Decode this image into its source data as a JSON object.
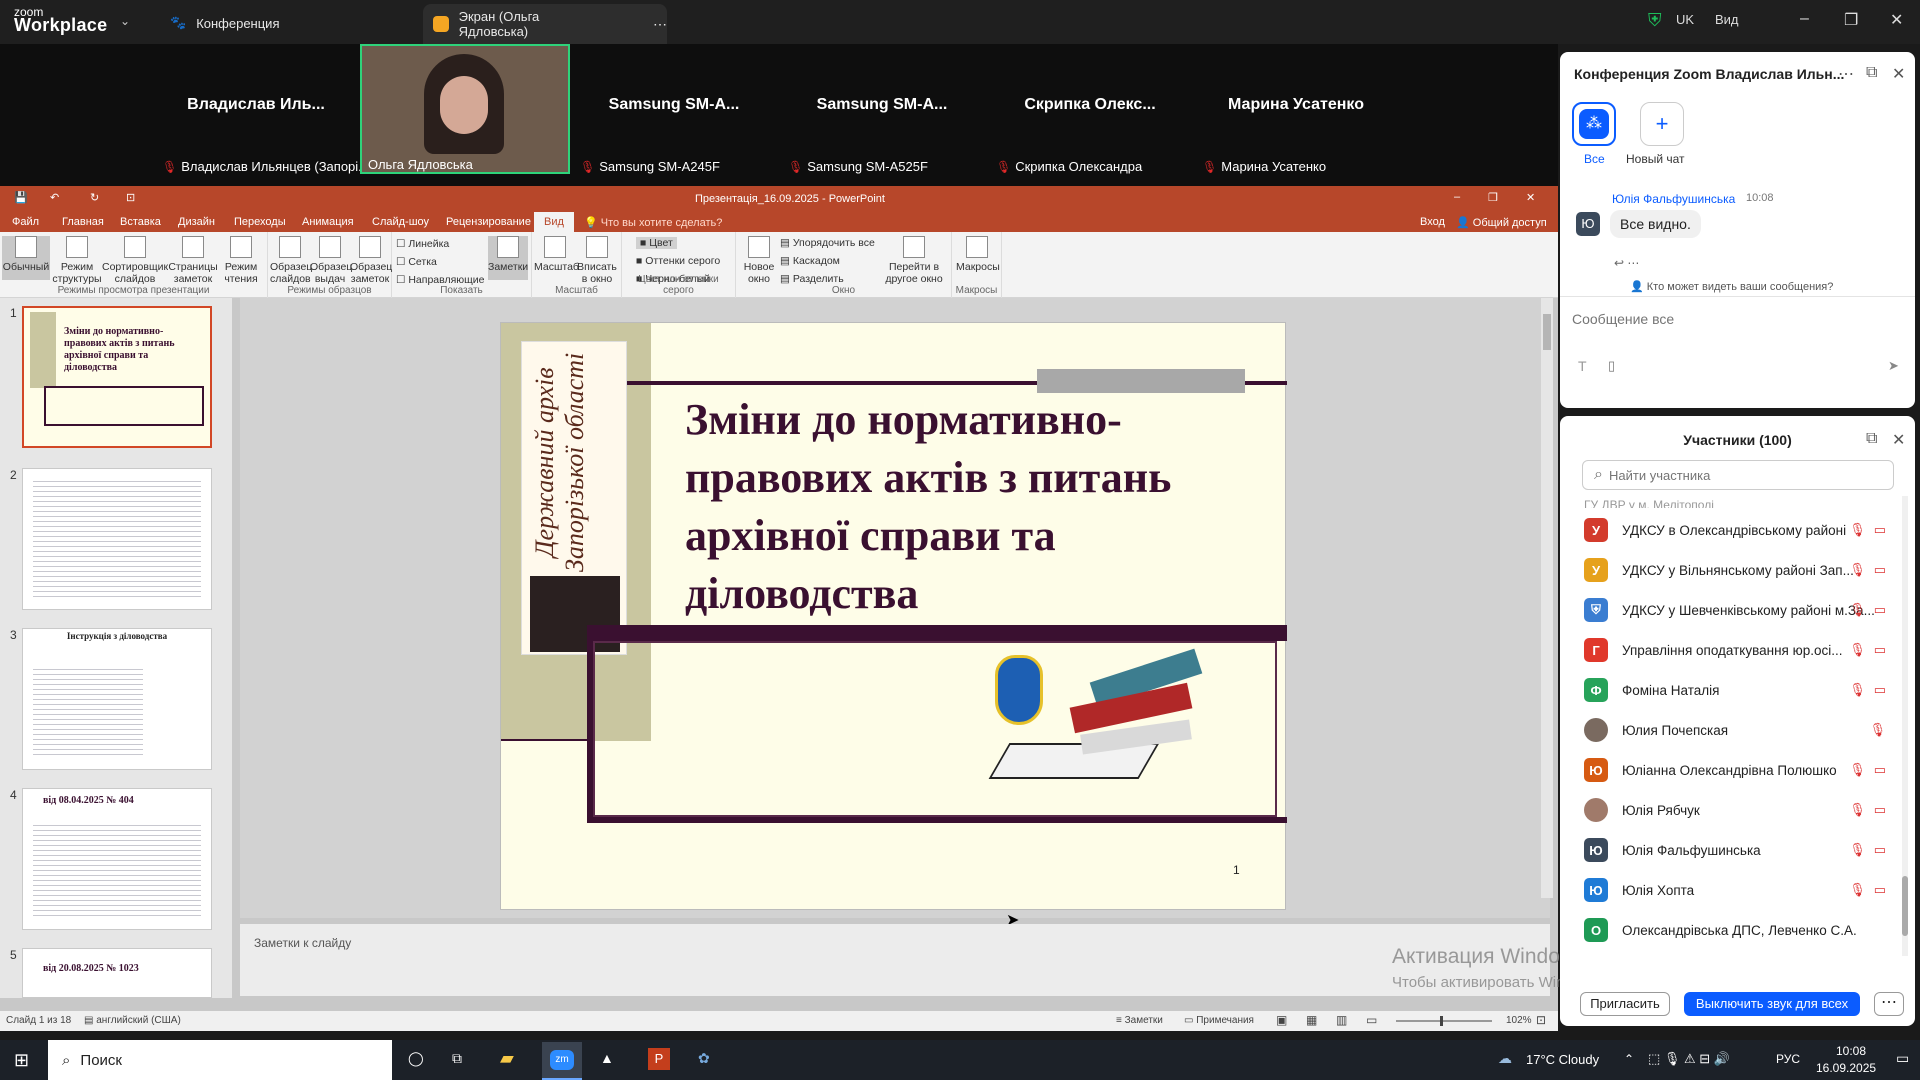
{
  "zoom": {
    "logo_top": "zoom",
    "logo_bottom": "Workplace",
    "tab_conference": "Конференция",
    "tab_screen": "Экран (Ольга Ядловська)",
    "region": "UK",
    "view": "Вид"
  },
  "gallery": [
    {
      "name": "Владислав Иль...",
      "label": "Владислав Ильянцев (Запорі..."
    },
    {
      "name": "",
      "label": "Ольга Ядловська"
    },
    {
      "name": "Samsung SM-A...",
      "label": "Samsung SM-A245F"
    },
    {
      "name": "Samsung SM-A...",
      "label": "Samsung SM-A525F"
    },
    {
      "name": "Скрипка Олекс...",
      "label": "Скрипка Олександра"
    },
    {
      "name": "Марина Усатенко",
      "label": "Марина Усатенко"
    }
  ],
  "ppt": {
    "title": "Презентація_16.09.2025 - PowerPoint",
    "menu": [
      "Файл",
      "Главная",
      "Вставка",
      "Дизайн",
      "Переходы",
      "Анимация",
      "Слайд-шоу",
      "Рецензирование",
      "Вид"
    ],
    "tell_me": "Что вы хотите сделать?",
    "signin": "Вход",
    "share": "Общий доступ",
    "ribbon": {
      "views": [
        "Обычный",
        "Режим структуры",
        "Сортировщик слайдов",
        "Страницы заметок",
        "Режим чтения"
      ],
      "views_label": "Режимы просмотра презентации",
      "masters": [
        "Образец слайдов",
        "Образец выдач",
        "Образец заметок"
      ],
      "masters_label": "Режимы образцов",
      "show": [
        "Линейка",
        "Сетка",
        "Направляющие"
      ],
      "notes": "Заметки",
      "show_label": "Показать",
      "zoom": [
        "Масштаб",
        "Вписать в окно"
      ],
      "zoom_label": "Масштаб",
      "color": [
        "Цвет",
        "Оттенки серого",
        "Черно-белый"
      ],
      "color_label": "Цвет или оттенки серого",
      "window": [
        "Новое окно",
        "Упорядочить все",
        "Каскадом",
        "Разделить",
        "Перейти в другое окно"
      ],
      "window_label": "Окно",
      "macros": "Макросы",
      "macros_label": "Макросы"
    },
    "thumb_numbers": [
      "1",
      "2",
      "3",
      "4",
      "5"
    ],
    "thumb1_title": "Зміни до нормативно-правових актів з питань архівної справи та діловодства",
    "thumb3_title": "Інструкція з діловодства",
    "thumb4_title": "від 08.04.2025 № 404",
    "thumb5_title": "від 20.08.2025 № 1023",
    "slide_title": "Зміни до нормативно-правових актів з питань архівної справи та діловодства",
    "slide_vertical": "Державний архів Запорізької області",
    "slide_number": "1",
    "notes_placeholder": "Заметки к слайду",
    "status_slide": "Слайд 1 из 18",
    "status_lang": "английский (США)",
    "status_notes": "Заметки",
    "status_comments": "Примечания",
    "status_zoom": "102%"
  },
  "chat": {
    "title": "Конференция Zoom Владислав Ильн...",
    "all": "Все",
    "new_chat": "Новый чат",
    "sender": "Юлія Фальфушинська",
    "time": "10:08",
    "avatar": "Ю",
    "message": "Все видно.",
    "who_can_see": "Кто может видеть ваши сообщения?",
    "input_placeholder": "Сообщение все"
  },
  "participants": {
    "title": "Участники (100)",
    "search_placeholder": "Найти участника",
    "rows": [
      {
        "av": "У",
        "color": "#d33b2c",
        "name": "УДКСУ в Олександрівському районі"
      },
      {
        "av": "У",
        "color": "#e6a11c",
        "name": "УДКСУ у Вільнянському районі Зап..."
      },
      {
        "av": "",
        "color": "#3a7dd1",
        "name": "УДКСУ у Шевченківському районі м.За..."
      },
      {
        "av": "Г",
        "color": "#e0382b",
        "name": "Управління оподаткування юр.осі..."
      },
      {
        "av": "Ф",
        "color": "#27a35a",
        "name": "Фоміна Наталія"
      },
      {
        "av": "",
        "color": "#7a6a60",
        "name": "Юлия Почепская"
      },
      {
        "av": "Ю",
        "color": "#d65a12",
        "name": "Юліанна Олександрівна Полюшко"
      },
      {
        "av": "",
        "color": "#a07a6a",
        "name": "Юлія Рябчук"
      },
      {
        "av": "Ю",
        "color": "#3b4a5c",
        "name": "Юлія Фальфушинська"
      },
      {
        "av": "Ю",
        "color": "#1f7bd6",
        "name": "Юлія Хопта"
      },
      {
        "av": "О",
        "color": "#1e9a55",
        "name": "Олександрівська ДПС,  Левченко С.А."
      }
    ],
    "top_cut": "ГУ ДВР у м. Мелітополі",
    "invite": "Пригласить",
    "mute_all": "Выключить звук для всех"
  },
  "watermark": {
    "line1": "Активация Windows",
    "line2": "Чтобы активировать Windows, перейдите в раздел \"Параметры\"."
  },
  "taskbar": {
    "search": "Поиск",
    "weather": "17°C Cloudy",
    "lang": "РУС",
    "time": "10:08",
    "date": "16.09.2025"
  }
}
